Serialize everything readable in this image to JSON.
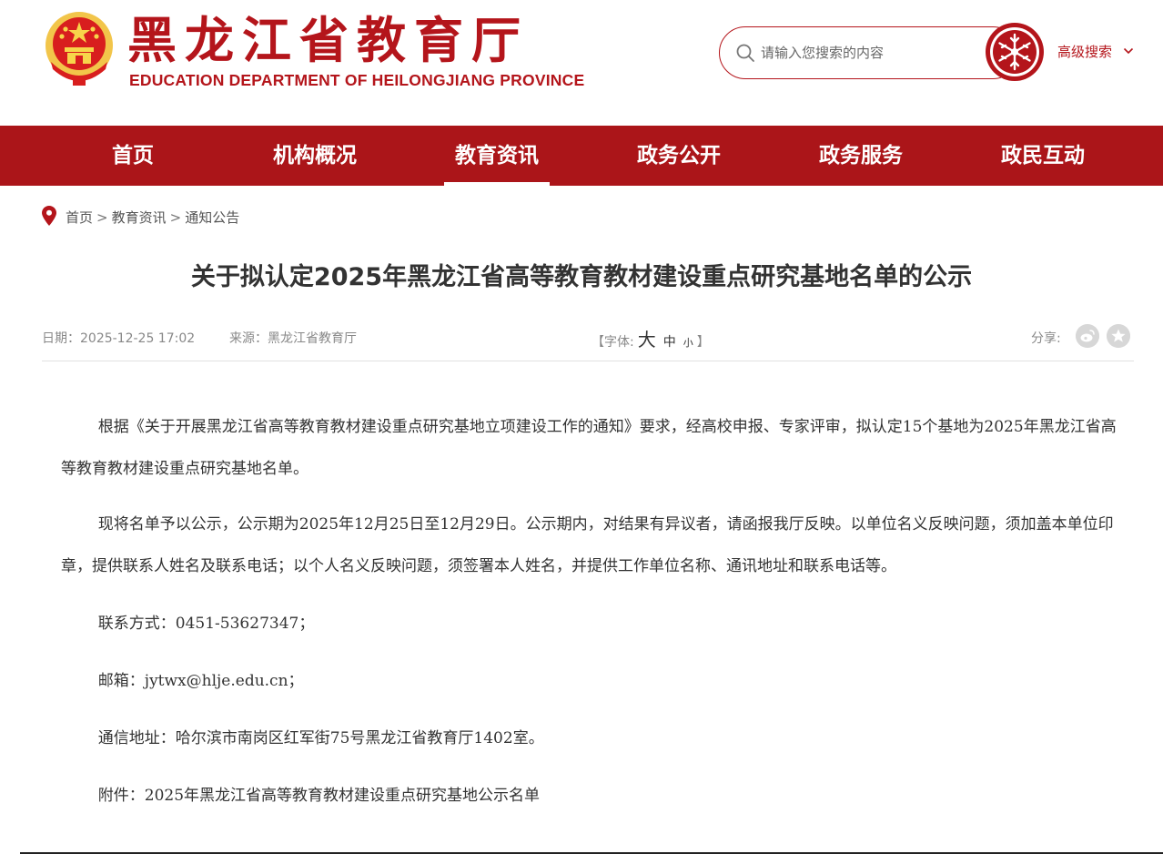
{
  "header": {
    "title_cn": "黑龙江省教育厅",
    "title_en": "EDUCATION DEPARTMENT OF HEILONGJIANG PROVINCE",
    "search_placeholder": "请输入您搜索的内容",
    "advanced_search": "高级搜索",
    "brand_color": "#b4151b"
  },
  "nav": {
    "items": [
      {
        "label": "首页"
      },
      {
        "label": "机构概况"
      },
      {
        "label": "教育资讯"
      },
      {
        "label": "政务公开"
      },
      {
        "label": "政务服务"
      },
      {
        "label": "政民互动"
      }
    ],
    "active_label": "教育资讯"
  },
  "breadcrumb": {
    "items": [
      "首页",
      "教育资讯",
      "通知公告"
    ],
    "separator": ">"
  },
  "article": {
    "title": "关于拟认定2025年黑龙江省高等教育教材建设重点研究基地名单的公示",
    "date": "日期：2025-12-25 17:02",
    "source": "来源：黑龙江省教育厅",
    "font_label_open": "【字体:",
    "font_large": "大",
    "font_medium": "中",
    "font_small": "小",
    "font_label_close": "】",
    "share_label": "分享:",
    "share_icons": [
      "weibo-icon",
      "favorite-star-icon"
    ],
    "paragraphs": [
      "根据《关于开展黑龙江省高等教育教材建设重点研究基地立项建设工作的通知》要求，经高校申报、专家评审，拟认定15个基地为2025年黑龙江省高等教育教材建设重点研究基地名单。",
      "现将名单予以公示，公示期为2025年12月25日至12月29日。公示期内，对结果有异议者，请函报我厅反映。以单位名义反映问题，须加盖本单位印章，提供联系人姓名及联系电话；以个人名义反映问题，须签署本人姓名，并提供工作单位名称、通讯地址和联系电话等。",
      "联系方式：0451-53627347；",
      "邮箱：jytwx@hlje.edu.cn；",
      "通信地址：哈尔滨市南岗区红军街75号黑龙江省教育厅1402室。",
      "附件：2025年黑龙江省高等教育教材建设重点研究基地公示名单"
    ]
  }
}
